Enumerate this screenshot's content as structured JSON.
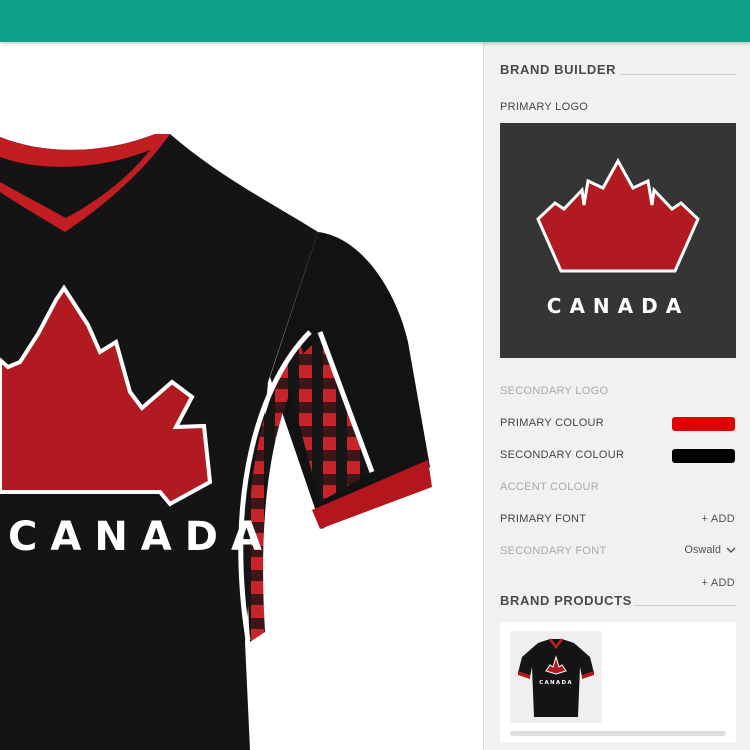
{
  "colors": {
    "topbar": "#0fa08a",
    "primary_swatch": "#e10000",
    "secondary_swatch": "#000000"
  },
  "canvas": {
    "jersey_text": "CANADA"
  },
  "brand_builder": {
    "title": "BRAND BUILDER",
    "primary_logo_label": "PRIMARY LOGO",
    "logo_text": "CANADA",
    "secondary_logo_label": "SECONDARY LOGO",
    "primary_colour_label": "PRIMARY COLOUR",
    "secondary_colour_label": "SECONDARY COLOUR",
    "accent_colour_label": "ACCENT COLOUR",
    "primary_font_label": "PRIMARY FONT",
    "primary_font_add": "+ ADD",
    "secondary_font_label": "SECONDARY FONT",
    "secondary_font_value": "Oswald",
    "extra_add": "+ ADD"
  },
  "brand_products": {
    "title": "BRAND PRODUCTS",
    "thumb_text": "CANADA"
  }
}
